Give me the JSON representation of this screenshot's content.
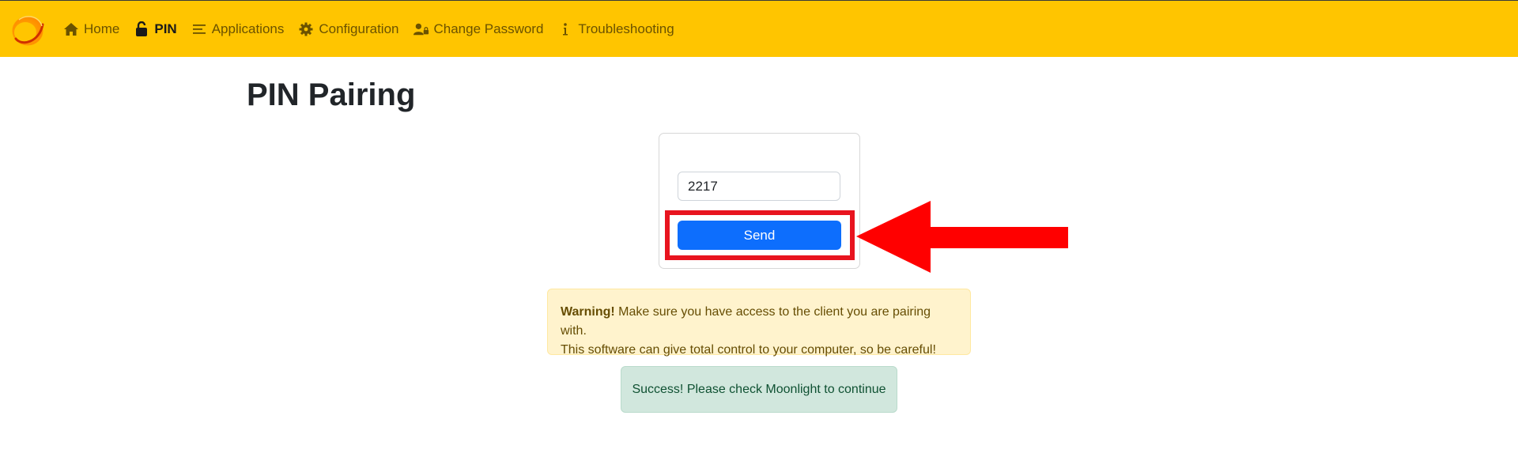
{
  "nav": {
    "items": [
      {
        "label": "Home",
        "icon": "home-icon"
      },
      {
        "label": "PIN",
        "icon": "lock-icon",
        "active": true
      },
      {
        "label": "Applications",
        "icon": "list-icon"
      },
      {
        "label": "Configuration",
        "icon": "gear-icon"
      },
      {
        "label": "Change Password",
        "icon": "user-lock-icon"
      },
      {
        "label": "Troubleshooting",
        "icon": "info-icon"
      }
    ]
  },
  "page": {
    "title": "PIN Pairing"
  },
  "pin_form": {
    "pin_value": "2217",
    "send_label": "Send"
  },
  "warning": {
    "strong": "Warning!",
    "text_line1": " Make sure you have access to the client you are pairing with.",
    "text_line2": "This software can give total control to your computer, so be careful!"
  },
  "success": {
    "text": "Success! Please check Moonlight to continue"
  },
  "colors": {
    "navbar": "#ffc500",
    "primary": "#0d6efd",
    "highlight": "#e8141f",
    "arrow": "#ff0000"
  }
}
